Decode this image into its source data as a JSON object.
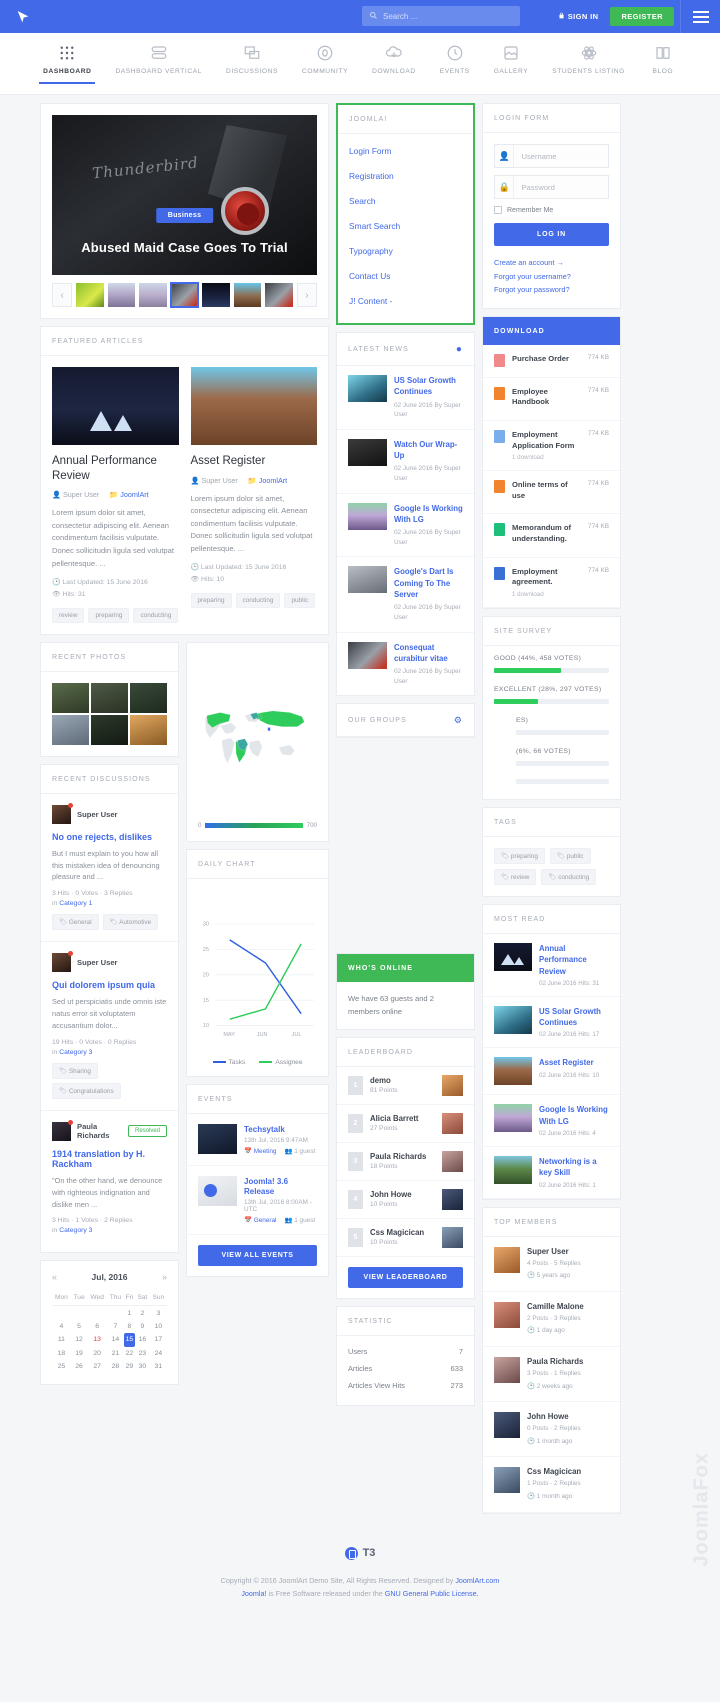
{
  "topbar": {
    "search_placeholder": "Search ...",
    "signin_label": "SIGN IN",
    "register_label": "REGISTER"
  },
  "nav": [
    {
      "label": "DASHBOARD",
      "icon": "grid-icon",
      "active": true
    },
    {
      "label": "DASHBOARD VERTICAL",
      "icon": "layers-icon"
    },
    {
      "label": "DISCUSSIONS",
      "icon": "chat-icon"
    },
    {
      "label": "COMMUNITY",
      "icon": "circle-icon"
    },
    {
      "label": "DOWNLOAD",
      "icon": "cloud-download-icon"
    },
    {
      "label": "EVENTS",
      "icon": "clock-icon"
    },
    {
      "label": "GALLERY",
      "icon": "image-icon"
    },
    {
      "label": "STUDENTS LISTING",
      "icon": "atom-icon"
    },
    {
      "label": "BLOG",
      "icon": "book-icon"
    }
  ],
  "hero": {
    "badge": "Business",
    "title": "Abused Maid Case Goes To Trial",
    "script_text": "Thunderbird",
    "prev": "‹",
    "next": "›"
  },
  "featured": {
    "header": "FEATURED ARTICLES",
    "articles": [
      {
        "title": "Annual Performance Review",
        "author": "Super User",
        "category": "JoomlArt",
        "excerpt": "Lorem ipsum dolor sit amet, consectetur adipiscing elit. Aenean condimentum facilisis vulputate. Donec sollicitudin ligula sed volutpat pellentesque. ...",
        "updated": "Last Updated: 15 June 2016",
        "hits": "Hits: 31",
        "tags": [
          "review",
          "preparing",
          "conducting"
        ]
      },
      {
        "title": "Asset Register",
        "author": "Super User",
        "category": "JoomlArt",
        "excerpt": "Lorem ipsum dolor sit amet, consectetur adipiscing elit. Aenean condimentum facilisis vulputate. Donec sollicitudin ligula sed volutpat pellentesque. ...",
        "updated": "Last Updated: 15 June 2016",
        "hits": "Hits: 10",
        "tags": [
          "preparing",
          "conducting",
          "public"
        ]
      }
    ]
  },
  "recent_photos": {
    "header": "RECENT PHOTOS"
  },
  "recent_discussions": {
    "header": "RECENT DISCUSSIONS",
    "items": [
      {
        "user": "Super User",
        "title": "No one rejects, dislikes",
        "excerpt": "But I must explain to you how all this mistaken idea of denouncing pleasure and ...",
        "stats": "3 Hits  · 0 Votes  · 3 Replies",
        "category_prefix": "in",
        "category": "Category 1",
        "tags": [
          "General",
          "Automotive"
        ],
        "resolved": ""
      },
      {
        "user": "Super User",
        "title": "Qui dolorem ipsum quia",
        "excerpt": "Sed ut perspiciatis unde omnis iste natus error sit voluptatem accusantium dolor...",
        "stats": "19 Hits  · 0 Votes  · 0 Replies",
        "category_prefix": "in",
        "category": "Category 3",
        "tags": [
          "Sharing",
          "Congratulations"
        ],
        "resolved": ""
      },
      {
        "user": "Paula Richards",
        "title": "1914 translation by H. Rackham",
        "excerpt": "\"On the other hand, we denounce with righteous indignation and dislike men ...",
        "stats": "3 Hits  · 1 Votes  · 2 Replies",
        "category_prefix": "in",
        "category": "Category 3",
        "tags": [],
        "resolved": "Resolved"
      }
    ]
  },
  "calendar": {
    "month": "Jul, 2016",
    "prev": "«",
    "next": "»",
    "weekdays": [
      "Mon",
      "Tue",
      "Wed",
      "Thu",
      "Fri",
      "Sat",
      "Sun"
    ],
    "weeks": [
      [
        "",
        "",
        "",
        "",
        "1",
        "2",
        "3"
      ],
      [
        "4",
        "5",
        "6",
        "7",
        "8",
        "9",
        "10"
      ],
      [
        "11",
        "12",
        "13",
        "14",
        "15",
        "16",
        "17"
      ],
      [
        "18",
        "19",
        "20",
        "21",
        "22",
        "23",
        "24"
      ],
      [
        "25",
        "26",
        "27",
        "28",
        "29",
        "30",
        "31"
      ]
    ],
    "today": "13",
    "highlight": "15"
  },
  "joomla_menu": {
    "header": "JOOMLA!",
    "items": [
      "Login Form",
      "Registration",
      "Search",
      "Smart Search",
      "Typography",
      "Contact Us",
      "J! Content -"
    ]
  },
  "latest_news": {
    "header": "LATEST NEWS",
    "items": [
      {
        "title": "US Solar Growth Continues",
        "meta": "02 June 2016 By Super User",
        "thumb": "n1"
      },
      {
        "title": "Watch Our Wrap-Up",
        "meta": "02 June 2016 By Super User",
        "thumb": "n2"
      },
      {
        "title": "Google Is Working With LG",
        "meta": "02 June 2016 By Super User",
        "thumb": "n3"
      },
      {
        "title": "Google's Dart Is Coming To The Server",
        "meta": "02 June 2016 By Super User",
        "thumb": "n4"
      },
      {
        "title": "Consequat curabitur vitae",
        "meta": "02 June 2016 By Super User",
        "thumb": "n5"
      }
    ]
  },
  "our_groups": {
    "header": "OUR GROUPS"
  },
  "map": {
    "legend_min": "0",
    "legend_max": "700"
  },
  "daily_chart": {
    "header": "DAILY CHART"
  },
  "chart_data": {
    "type": "line",
    "title": "DAILY CHART",
    "x": [
      "MAY",
      "JUN",
      "JUL"
    ],
    "ylim": [
      10,
      32
    ],
    "yticks": [
      10,
      15,
      20,
      25,
      30
    ],
    "grid": true,
    "legend_position": "bottom",
    "series": [
      {
        "name": "Tasks",
        "color": "#2f5fe0",
        "values": [
          26,
          23,
          13
        ]
      },
      {
        "name": "Assignee",
        "color": "#2ecc5b",
        "values": [
          12,
          14,
          26
        ]
      }
    ]
  },
  "events": {
    "header": "EVENTS",
    "items": [
      {
        "title": "Techsytalk",
        "datetime": "13th Jul, 2016 9:47AM",
        "type": "Meeting",
        "guests": "1 guest"
      },
      {
        "title": "Joomla! 3.6 Release",
        "datetime": "13th Jul, 2016 8:00AM - UTC",
        "type": "General",
        "guests": "1 guest"
      }
    ],
    "view_all": "VIEW ALL EVENTS"
  },
  "whos_online": {
    "header": "WHO'S ONLINE",
    "text": "We have 63 guests and 2 members online"
  },
  "leaderboard": {
    "header": "LEADERBOARD",
    "rows": [
      {
        "rank": "1",
        "name": "demo",
        "points": "81 Points",
        "av": "la1"
      },
      {
        "rank": "2",
        "name": "Alicia Barrett",
        "points": "27 Points",
        "av": "la2"
      },
      {
        "rank": "3",
        "name": "Paula Richards",
        "points": "18 Points",
        "av": "la3"
      },
      {
        "rank": "4",
        "name": "John Howe",
        "points": "10 Points",
        "av": "la4"
      },
      {
        "rank": "5",
        "name": "Css Magicican",
        "points": "10 Points",
        "av": "la5"
      }
    ],
    "view_button": "VIEW LEADERBOARD"
  },
  "statistic": {
    "header": "STATISTIC",
    "rows": [
      {
        "label": "Users",
        "value": "7"
      },
      {
        "label": "Articles",
        "value": "633"
      },
      {
        "label": "Articles View Hits",
        "value": "273"
      }
    ]
  },
  "login_form": {
    "header": "LOGIN FORM",
    "username_placeholder": "Username",
    "password_placeholder": "Password",
    "remember_label": "Remember Me",
    "submit_label": "LOG IN",
    "links": [
      "Create an account →",
      "Forgot your username?",
      "Forgot your password?"
    ]
  },
  "download": {
    "header": "DOWNLOAD",
    "items": [
      {
        "name": "Purchase Order",
        "size": "774 KB",
        "sub": "",
        "color": "#f08a8a"
      },
      {
        "name": "Employee Handbook",
        "size": "774 KB",
        "sub": "",
        "color": "#f2832f"
      },
      {
        "name": "Employment Application Form",
        "size": "774 KB",
        "sub": "1 download",
        "color": "#7aaeea"
      },
      {
        "name": "Online terms of use",
        "size": "774 KB",
        "sub": "",
        "color": "#f2832f"
      },
      {
        "name": "Memorandum of understanding.",
        "size": "774 KB",
        "sub": "",
        "color": "#1ebf7a"
      },
      {
        "name": "Employment agreement.",
        "size": "774 KB",
        "sub": "1 download",
        "color": "#3b6fd4"
      }
    ]
  },
  "site_survey": {
    "header": "SITE SURVEY",
    "items": [
      {
        "label": "GOOD (44%, 458 VOTES)",
        "percent": 58
      },
      {
        "label": "EXCELLENT (28%, 297 VOTES)",
        "percent": 38
      },
      {
        "label": "ES)",
        "percent": 0
      },
      {
        "label": "(6%, 66 VOTES)",
        "percent": 0
      },
      {
        "label": "",
        "percent": 0
      }
    ]
  },
  "tags_card": {
    "header": "TAGS",
    "tags": [
      "preparing",
      "public",
      "review",
      "conducting"
    ]
  },
  "most_read": {
    "header": "MOST READ",
    "items": [
      {
        "title": "Annual Performance Review",
        "meta": "02 June 2016 Hits: 31",
        "thumb": "m1"
      },
      {
        "title": "US Solar Growth Continues",
        "meta": "02 June 2016 Hits: 17",
        "thumb": "m2"
      },
      {
        "title": "Asset Register",
        "meta": "02 June 2016 Hits: 10",
        "thumb": "m3"
      },
      {
        "title": "Google Is Working With LG",
        "meta": "02 June 2016 Hits: 4",
        "thumb": "m4"
      },
      {
        "title": "Networking is a key Skill",
        "meta": "02 June 2016 Hits: 1",
        "thumb": "m5"
      }
    ]
  },
  "top_members": {
    "header": "TOP MEMBERS",
    "members": [
      {
        "name": "Super User",
        "stats": "4 Posts  · 5 Replies",
        "time": "5 years ago",
        "av": "la1"
      },
      {
        "name": "Camille Malone",
        "stats": "2 Posts  · 3 Replies",
        "time": "1 day ago",
        "av": "la2"
      },
      {
        "name": "Paula Richards",
        "stats": "3 Posts  · 1 Replies",
        "time": "2 weeks ago",
        "av": "la3"
      },
      {
        "name": "John Howe",
        "stats": "0 Posts  · 2 Replies",
        "time": "1 month ago",
        "av": "la4"
      },
      {
        "name": "Css Magicican",
        "stats": "1 Posts  · 2 Replies",
        "time": "1 month ago",
        "av": "la5"
      }
    ]
  },
  "footer": {
    "brand": "T3",
    "copyright_prefix": "Copyright © 2016 JoomlArt Demo Site, All Rights Reserved. Designed by ",
    "copyright_link": "JoomlArt.com",
    "license_a": "Joomla!",
    "license_mid": " is Free Software released under the ",
    "license_b": "GNU General Public License."
  },
  "watermark": "JoomlaFox",
  "colors": {
    "brand_blue": "#4269e8",
    "green": "#3fb955",
    "link": "#4269e8"
  }
}
